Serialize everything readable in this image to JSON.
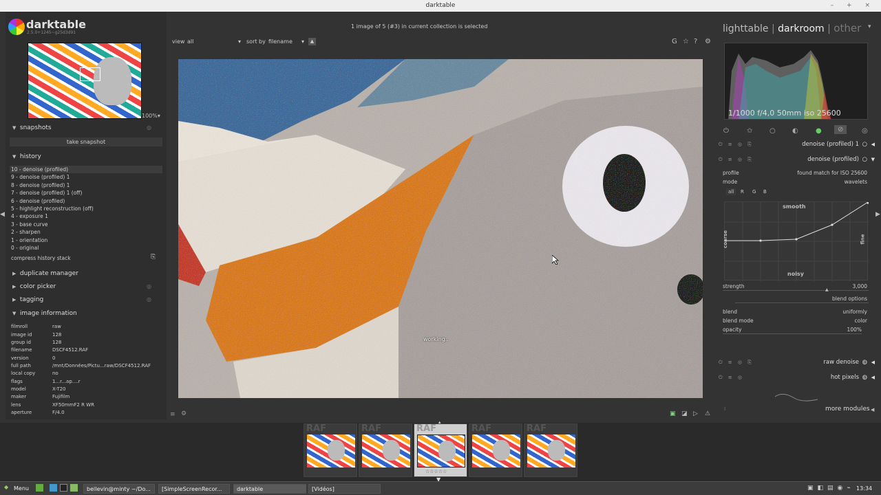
{
  "window": {
    "title": "darktable",
    "controls": "– + ×"
  },
  "app": {
    "name": "darktable",
    "version": "2.5.0+1245~g25d3d91"
  },
  "navigation": {
    "zoom": "100%▾"
  },
  "snapshots": {
    "title": "snapshots",
    "take_snapshot": "take snapshot"
  },
  "history": {
    "title": "history",
    "items": [
      "10 - denoise (profiled)",
      "9 - denoise (profiled) 1",
      "8 - denoise (profiled) 1",
      "7 - denoise (profiled) 1 (off)",
      "6 - denoise (profiled)",
      "5 - highlight reconstruction (off)",
      "4 - exposure 1",
      "3 - base curve",
      "2 - sharpen",
      "1 - orientation",
      "0 - original"
    ],
    "compress": "compress history stack"
  },
  "sections": {
    "duplicate_manager": "duplicate manager",
    "color_picker": "color picker",
    "tagging": "tagging",
    "image_information": "image information"
  },
  "image_info": [
    {
      "k": "filmroll",
      "v": "raw"
    },
    {
      "k": "image id",
      "v": "128"
    },
    {
      "k": "group id",
      "v": "128"
    },
    {
      "k": "filename",
      "v": "DSCF4512.RAF"
    },
    {
      "k": "version",
      "v": "0"
    },
    {
      "k": "full path",
      "v": "/mnt/Données/Pictu...raw/DSCF4512.RAF"
    },
    {
      "k": "local copy",
      "v": "no"
    },
    {
      "k": "flags",
      "v": "1...r...ap....r"
    },
    {
      "k": "model",
      "v": "X-T20"
    },
    {
      "k": "maker",
      "v": "Fujifilm"
    },
    {
      "k": "lens",
      "v": "XF50mmF2 R WR"
    },
    {
      "k": "aperture",
      "v": "F/4.0"
    }
  ],
  "center": {
    "status": "1 image of 5 (#3) in current collection is selected",
    "view_label": "view",
    "view_value": "all",
    "sort_label": "sort by",
    "sort_value": "filename",
    "working": "working.."
  },
  "views": {
    "lighttable": "lighttable",
    "darkroom": "darkroom",
    "other": "other",
    "sep": "|"
  },
  "histogram": {
    "exif": "1/1000 f/4,0 50mm iso 25600"
  },
  "modules": {
    "denoise1": "denoise (profiled) 1",
    "denoise": "denoise (profiled)",
    "raw_denoise": "raw denoise",
    "hot_pixels": "hot pixels",
    "more_modules": "more modules"
  },
  "denoise_params": {
    "profile_label": "profile",
    "profile_value": "found match for ISO 25600",
    "mode_label": "mode",
    "mode_value": "wavelets",
    "channels": [
      "all",
      "R",
      "G",
      "B"
    ],
    "smooth": "smooth",
    "noisy": "noisy",
    "coarse": "coarse",
    "fine": "fine",
    "strength_label": "strength",
    "strength_value": "3,000",
    "blend_options": "blend options",
    "blend_label": "blend",
    "blend_value": "uniformly",
    "blend_mode_label": "blend mode",
    "blend_mode_value": "color",
    "opacity_label": "opacity",
    "opacity_value": "100%"
  },
  "taskbar": {
    "menu": "Menu",
    "tasks": [
      "bellevin@minty ~/Do...",
      "[SimpleScreenRecor...",
      "darktable",
      "[Vidéos]"
    ],
    "clock": "13:34"
  },
  "colors": {
    "accent": "#c8c8c8",
    "bg": "#333333"
  }
}
